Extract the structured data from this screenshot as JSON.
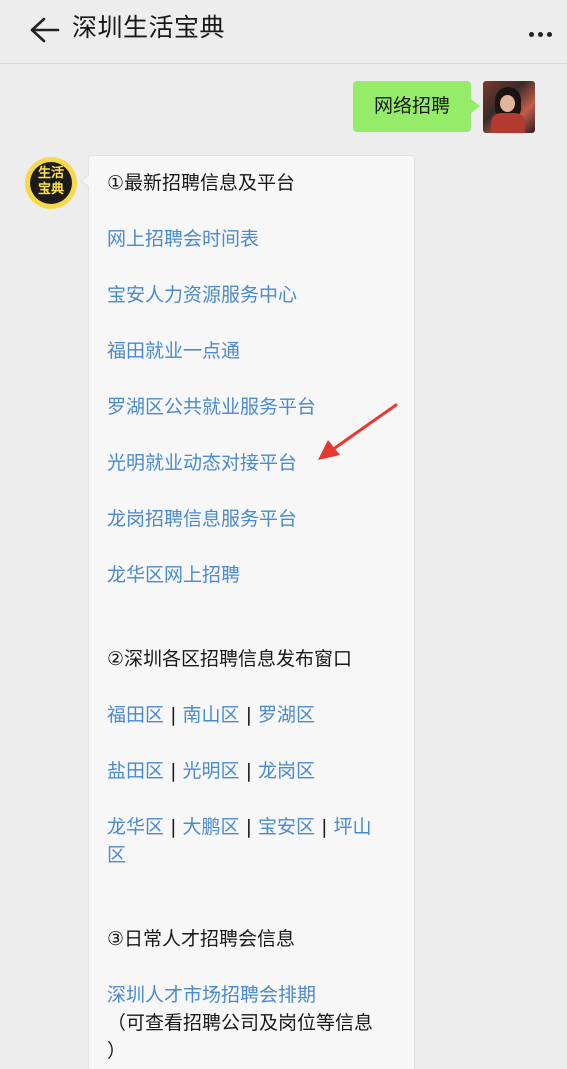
{
  "header": {
    "title": "深圳生活宝典"
  },
  "chat": {
    "user_message": "网络招聘",
    "bot_avatar_text": [
      "生活",
      "宝典"
    ]
  },
  "sections": {
    "s1": {
      "heading": "①最新招聘信息及平台",
      "links": [
        "网上招聘会时间表",
        "宝安人力资源服务中心",
        "福田就业一点通",
        "罗湖区公共就业服务平台",
        "光明就业动态对接平台",
        "龙岗招聘信息服务平台",
        "龙华区网上招聘"
      ]
    },
    "s2": {
      "heading": "②深圳各区招聘信息发布窗口",
      "row1": [
        "福田区",
        "南山区",
        "罗湖区"
      ],
      "row2": [
        "盐田区",
        "光明区",
        "龙岗区"
      ],
      "row3": [
        "龙华区",
        "大鹏区",
        "宝安区",
        "坪山"
      ],
      "row3_wrap": "区",
      "separator": "|"
    },
    "s3": {
      "heading": "③日常人才招聘会信息",
      "link": "深圳人才市场招聘会排期",
      "note_line1": "（可查看招聘公司及岗位等信息",
      "note_line2": "）"
    }
  },
  "colors": {
    "link": "#4a8ad0",
    "user_bubble": "#95ec69",
    "annotation_arrow": "#e8372f"
  }
}
